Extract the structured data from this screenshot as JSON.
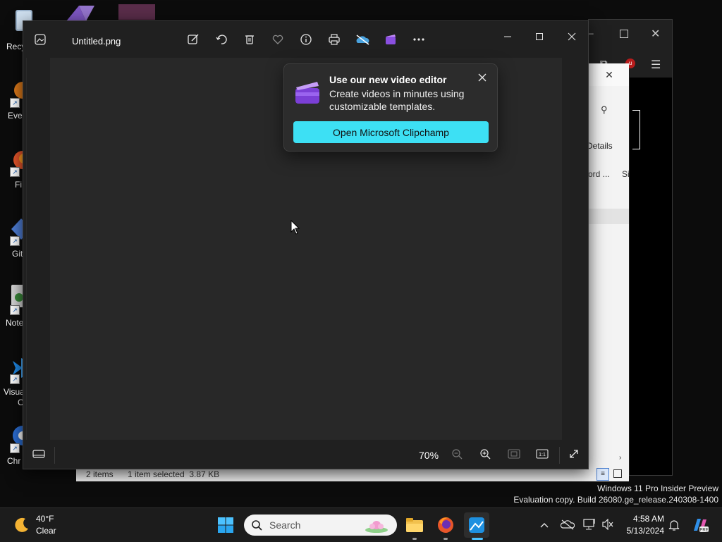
{
  "desktop": {
    "icons": [
      {
        "label": "Recy"
      },
      {
        "label": "Ever"
      },
      {
        "label": "Fi"
      },
      {
        "label": "Git"
      },
      {
        "label": "Note"
      },
      {
        "label": "Visua"
      },
      {
        "label": "C"
      },
      {
        "label": "Chr"
      }
    ],
    "watermark": {
      "line1": "Windows 11 Pro Insider Preview",
      "line2": "Evaluation copy. Build 26080.ge_release.240308-1400"
    }
  },
  "explorer": {
    "details_label": "Details",
    "col1": "ord ...",
    "col2": "Si",
    "status_items": "2 items",
    "status_selected": "1 item selected  3.87 KB"
  },
  "photos": {
    "title": "Untitled.png",
    "toolbar": [
      "edit-icon",
      "rotate-icon",
      "delete-icon",
      "favorite-icon",
      "info-icon",
      "print-icon",
      "onedrive-icon",
      "clipchamp-icon",
      "more-icon"
    ],
    "zoom": "70%"
  },
  "flyout": {
    "title": "Use our new video editor",
    "body": "Create videos in minutes using customizable templates.",
    "cta": "Open Microsoft Clipchamp"
  },
  "taskbar": {
    "weather_temp": "40°F",
    "weather_desc": "Clear",
    "search_placeholder": "Search",
    "time": "4:58 AM",
    "date": "5/13/2024"
  },
  "colors": {
    "accent": "#3de0f4",
    "window_bg": "#202020",
    "clipchamp": "#8a4fe0"
  }
}
